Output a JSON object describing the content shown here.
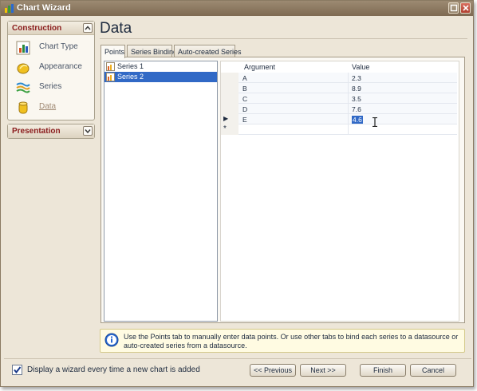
{
  "window": {
    "title": "Chart Wizard"
  },
  "sidebar": {
    "construction": {
      "header": "Construction",
      "items": [
        {
          "label": "Chart Type",
          "icon": "chart-type-icon"
        },
        {
          "label": "Appearance",
          "icon": "appearance-icon"
        },
        {
          "label": "Series",
          "icon": "series-icon"
        },
        {
          "label": "Data",
          "icon": "data-icon",
          "active": true
        }
      ]
    },
    "presentation": {
      "header": "Presentation"
    }
  },
  "main": {
    "title": "Data",
    "tabs": [
      {
        "label": "Points",
        "active": true
      },
      {
        "label": "Series Binding"
      },
      {
        "label": "Auto-created Series"
      }
    ],
    "series_list": [
      {
        "label": "Series 1",
        "selected": false
      },
      {
        "label": "Series 2",
        "selected": true
      }
    ],
    "grid": {
      "columns": [
        "Argument",
        "Value"
      ],
      "rows": [
        {
          "argument": "A",
          "value": "2.3"
        },
        {
          "argument": "B",
          "value": "8.9"
        },
        {
          "argument": "C",
          "value": "3.5"
        },
        {
          "argument": "D",
          "value": "7.6"
        },
        {
          "argument": "E",
          "value": "4.6",
          "current": true
        }
      ],
      "new_row_glyph": "*",
      "current_row_glyph": "▶"
    },
    "hint": "Use the Points tab to manually enter data points. Or use other tabs to bind each series to a datasource or auto-created series from a datasource."
  },
  "footer": {
    "checkbox_label": "Display a wizard every time a new chart is added",
    "checkbox_checked": true,
    "buttons": {
      "previous": "<< Previous",
      "next": "Next >>",
      "finish": "Finish",
      "cancel": "Cancel"
    }
  },
  "colors": {
    "selection": "#3169c6",
    "header_text": "#8a1b1b",
    "title_bar": "#8e7c64"
  }
}
